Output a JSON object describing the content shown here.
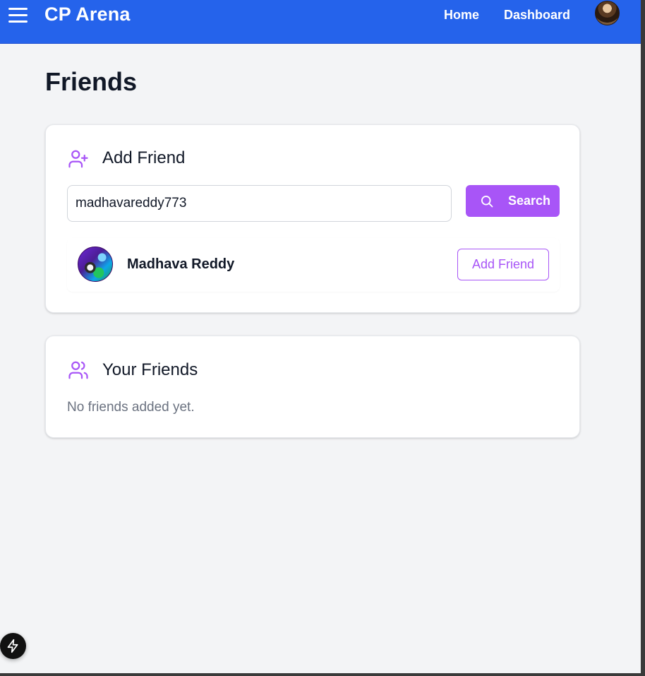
{
  "header": {
    "brand": "CP Arena",
    "nav": {
      "home": "Home",
      "dashboard": "Dashboard"
    },
    "bg_color": "#2563eb"
  },
  "page": {
    "title": "Friends"
  },
  "add_friend": {
    "title": "Add Friend",
    "search": {
      "value": "madhavareddy773"
    },
    "search_button": "Search",
    "result": {
      "name": "Madhava Reddy",
      "action": "Add Friend"
    },
    "accent_color": "#a855f7"
  },
  "your_friends": {
    "title": "Your Friends",
    "empty_message": "No friends added yet."
  },
  "icons": {
    "menu": "hamburger-menu-icon",
    "add_user": "user-plus-icon",
    "friends": "users-icon",
    "search": "search-icon",
    "fab": "lightning-icon"
  }
}
